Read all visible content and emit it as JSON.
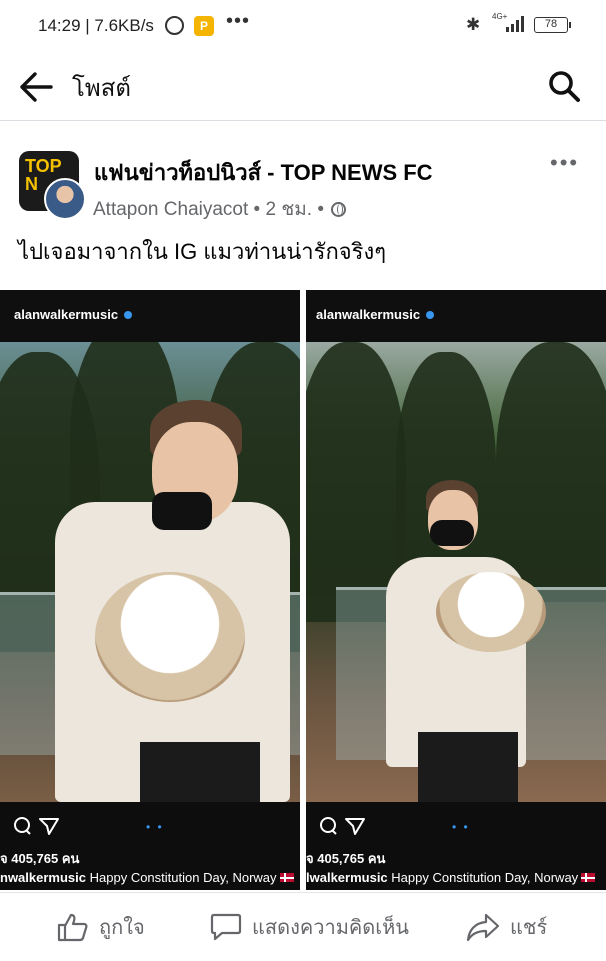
{
  "status_bar": {
    "time": "14:29 | 7.6KB/s",
    "network_type": "4G+",
    "battery": "78"
  },
  "header": {
    "title": "โพสต์"
  },
  "post": {
    "page_name": "แฟนข่าวท็อปนิวส์ - TOP NEWS FC",
    "page_logo_text": "TOP N",
    "author": "Attapon Chaiyacot",
    "time": "2 ชม.",
    "text": "ไปเจอมาจากใน IG แมวท่านน่ารักจริงๆ"
  },
  "photos": [
    {
      "username": "alanwalkermusic",
      "likes": "จ 405,765 คน",
      "caption_user": "nwalkermusic",
      "caption_text": "Happy Constitution Day, Norway"
    },
    {
      "username": "alanwalkermusic",
      "likes": "จ 405,765 คน",
      "caption_user": "lwalkermusic",
      "caption_text": "Happy Constitution Day, Norway"
    }
  ],
  "actions": {
    "like": "ถูกใจ",
    "comment": "แสดงความคิดเห็น",
    "share": "แชร์"
  }
}
